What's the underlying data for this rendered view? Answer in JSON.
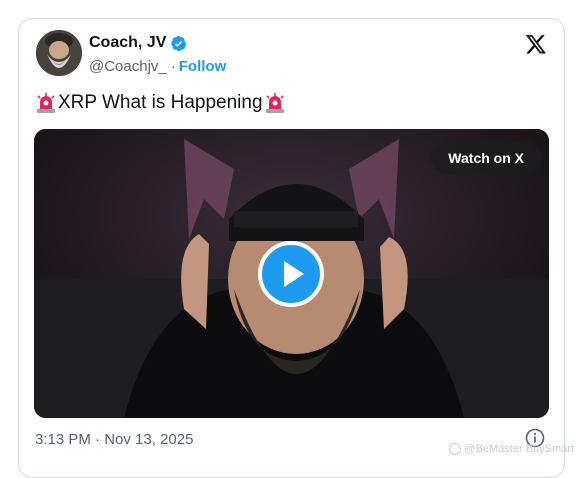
{
  "author": {
    "name": "Coach, JV",
    "handle": "@Coachjv_",
    "separator": "·",
    "follow_label": "Follow"
  },
  "tweet": {
    "text": "XRP What is Happening",
    "emoji_icon": "rotating-light-icon"
  },
  "media": {
    "watch_label": "Watch on X",
    "play_icon": "play-icon"
  },
  "footer": {
    "timestamp": "3:13 PM · Nov 13, 2025"
  },
  "watermark": {
    "text": "@BeMaster BuySmart"
  },
  "colors": {
    "accent": "#1d9bf0",
    "text": "#0f1419",
    "muted": "#536471",
    "border": "#cfd9de"
  }
}
